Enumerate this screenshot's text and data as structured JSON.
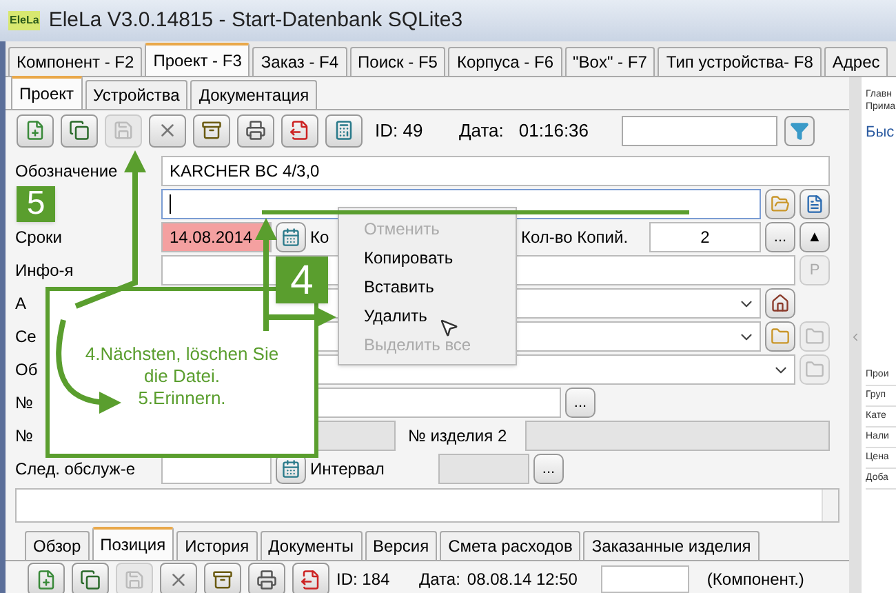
{
  "window": {
    "logo": "EleLa",
    "title": "EleLa V3.0.14815  - Start-Datenbank SQLite3"
  },
  "main_tabs": [
    {
      "label": "Компонент - F2",
      "selected": false
    },
    {
      "label": "Проект - F3",
      "selected": true
    },
    {
      "label": "Заказ - F4",
      "selected": false
    },
    {
      "label": "Поиск - F5",
      "selected": false
    },
    {
      "label": "Корпуса - F6",
      "selected": false
    },
    {
      "label": "\"Box\" - F7",
      "selected": false
    },
    {
      "label": "Тип устройства- F8",
      "selected": false
    },
    {
      "label": "Адрес",
      "selected": false
    }
  ],
  "sub_tabs": [
    {
      "label": "Проект",
      "selected": true
    },
    {
      "label": "Устройства",
      "selected": false
    },
    {
      "label": "Документация",
      "selected": false
    }
  ],
  "toolbar": {
    "buttons": [
      {
        "disabled": false
      },
      {
        "disabled": false
      },
      {
        "disabled": true
      },
      {
        "disabled": false
      },
      {
        "disabled": false
      },
      {
        "disabled": false
      },
      {
        "disabled": false
      },
      {
        "disabled": false
      }
    ],
    "id_label": "ID: 49",
    "date_label": "Дата:",
    "date": "01:16:36"
  },
  "form": {
    "rows": [
      {
        "kind": "text",
        "label": "Обозначение",
        "value": "KARCHER BC 4/3,0"
      },
      {
        "kind": "quantity",
        "focused": true
      },
      {
        "kind": "date",
        "label": "Сроки",
        "value": "14.08.2014",
        "overdue": true,
        "sublabel": "Ко",
        "copies_label": "Кол-во Копий.",
        "copies": "2",
        "more": "...",
        "toggle": "▲"
      },
      {
        "kind": "info",
        "label": "Инфо-я",
        "action": "P",
        "disabled": true
      },
      {
        "kind": "combo",
        "label": "А",
        "buttons": [
          {
            "disabled": false
          }
        ]
      },
      {
        "kind": "combo",
        "label": "Се",
        "buttons": [
          {
            "disabled": false
          },
          {
            "disabled": true
          }
        ]
      },
      {
        "kind": "combo_wide",
        "label": "Об",
        "buttons": [
          {
            "disabled": true
          }
        ]
      },
      {
        "kind": "number",
        "label": "№",
        "more": "..."
      },
      {
        "kind": "serial",
        "label": "№",
        "serial_label": "№ изделия 2"
      },
      {
        "kind": "service",
        "label": "След. обслуж-е",
        "interval_label": "Интервал",
        "more": "..."
      }
    ]
  },
  "context_menu": {
    "items": [
      {
        "label": "Отменить",
        "disabled": true
      },
      {
        "label": "Копировать",
        "disabled": false
      },
      {
        "label": "Вставить",
        "disabled": false
      },
      {
        "label": "Удалить",
        "disabled": false
      },
      {
        "label": "Выделить все",
        "disabled": true
      }
    ]
  },
  "callout": {
    "step_text": "4.Nächsten, löschen Sie die Datei.",
    "next_text": "5.Erinnern."
  },
  "steps": [
    "5",
    "4"
  ],
  "side_panel": {
    "top": [
      "Главн",
      "Прима"
    ],
    "heading": "Быс",
    "fields": [
      "Прои",
      "Груп",
      "Кате",
      "Нали",
      "Цена",
      "Доба"
    ]
  },
  "bottom_tabs": [
    {
      "label": "Обзор",
      "selected": false
    },
    {
      "label": "Позиция",
      "selected": true
    },
    {
      "label": "История",
      "selected": false
    },
    {
      "label": "Документы",
      "selected": false
    },
    {
      "label": "Версия",
      "selected": false
    },
    {
      "label": "Смета расходов",
      "selected": false
    },
    {
      "label": "Заказанные изделия",
      "selected": false
    }
  ],
  "bottom_toolbar": {
    "buttons": [
      {
        "disabled": false
      },
      {
        "disabled": false
      },
      {
        "disabled": true
      },
      {
        "disabled": false
      },
      {
        "disabled": false
      },
      {
        "disabled": false
      },
      {
        "disabled": false
      }
    ],
    "id_label": "ID: 184",
    "date_label": "Дата:",
    "date": "08.08.14 12:50",
    "component": "(Компонент.)"
  }
}
